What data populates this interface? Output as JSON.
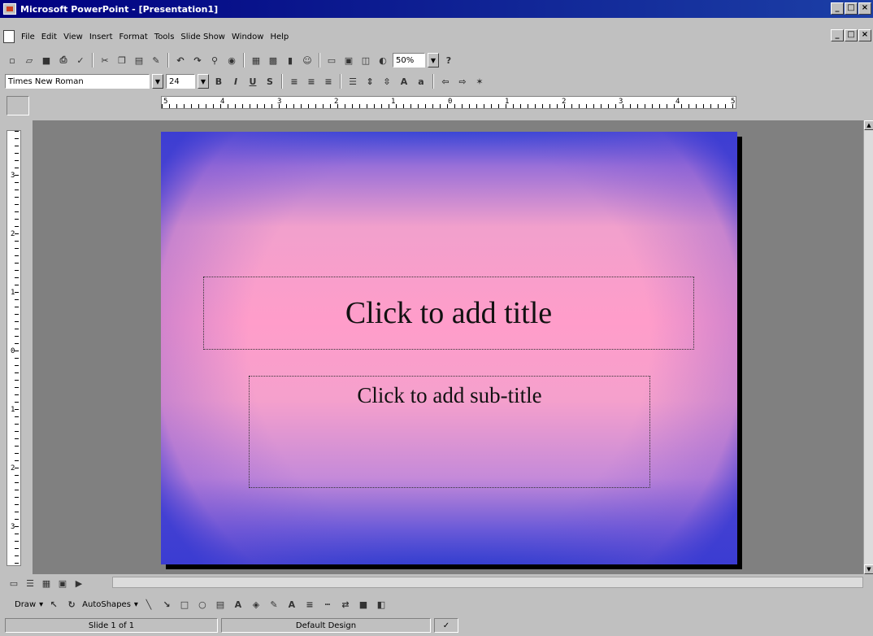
{
  "window": {
    "title": "Microsoft PowerPoint - [Presentation1]"
  },
  "menu": {
    "items": [
      "File",
      "Edit",
      "View",
      "Insert",
      "Format",
      "Tools",
      "Slide Show",
      "Window",
      "Help"
    ]
  },
  "formatting": {
    "font_name": "Times New Roman",
    "font_size": "24",
    "zoom": "50%"
  },
  "ruler": {
    "h_labels": [
      "5",
      "4",
      "3",
      "2",
      "1",
      "0",
      "1",
      "2",
      "3",
      "4",
      "5"
    ],
    "v_labels": [
      "3",
      "2",
      "1",
      "0",
      "1",
      "2",
      "3"
    ]
  },
  "slide": {
    "title_placeholder": "Click to add title",
    "subtitle_placeholder": "Click to add sub-title"
  },
  "drawing": {
    "draw_label": "Draw",
    "autoshapes_label": "AutoShapes"
  },
  "status": {
    "slide": "Slide 1 of 1",
    "design": "Default Design"
  },
  "colors": {
    "titlebar": "#000080",
    "slide_pink": "#ff9dca",
    "slide_blue": "#3a46d6",
    "workspace": "#808080"
  }
}
